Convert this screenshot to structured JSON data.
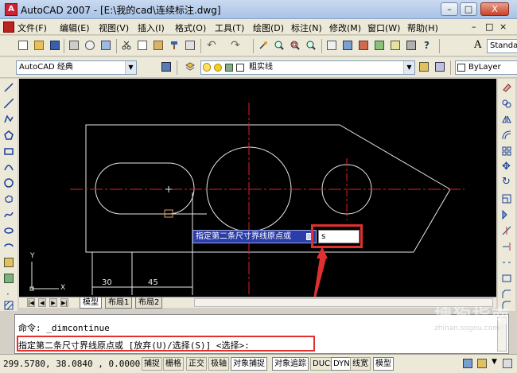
{
  "window": {
    "title": "AutoCAD 2007 - [E:\\我的cad\\连续标注.dwg]",
    "controls": [
      "–",
      "□",
      "X"
    ],
    "doc_controls": [
      "–",
      "□",
      "×"
    ]
  },
  "menu": {
    "items": [
      "文件(F)",
      "编辑(E)",
      "视图(V)",
      "插入(I)",
      "格式(O)",
      "工具(T)",
      "绘图(D)",
      "标注(N)",
      "修改(M)",
      "窗口(W)",
      "帮助(H)"
    ]
  },
  "toolbar": {
    "text_style_combo": "Standa",
    "workspace_combo": "AutoCAD 经典",
    "layer_combo": "粗实线",
    "color_combo": "ByLayer"
  },
  "drawing": {
    "dimensions": [
      "30",
      "45"
    ],
    "ucs_labels": {
      "x": "X",
      "y": "Y"
    }
  },
  "dynamic_input": {
    "prompt": "指定第二条尺寸界线原点或",
    "value": "s"
  },
  "layout_tabs": [
    "模型",
    "布局1",
    "布局2"
  ],
  "command": {
    "history_line": "命令: _dimcontinue",
    "current_prompt": "指定第二条尺寸界线原点或 [放弃(U)/选择(S)] <选择>:"
  },
  "status": {
    "coords": "299.5780, 38.0840 , 0.0000",
    "buttons": [
      "捕捉",
      "栅格",
      "正交",
      "极轴",
      "对象捕捉",
      "对象追踪",
      "DUCS",
      "DYN",
      "线宽",
      "模型"
    ],
    "active": [
      "对象捕捉",
      "对象追踪",
      "DYN",
      "模型"
    ]
  },
  "watermark": {
    "text": "搜狗指南",
    "sub": "zhinan.sogou.com"
  },
  "colors": {
    "canvas_bg": "#000000",
    "geometry": "#e8e8e8",
    "centerline": "#e02020",
    "highlight": "#e03030",
    "dyn_prompt_bg": "#2c3ca8"
  }
}
